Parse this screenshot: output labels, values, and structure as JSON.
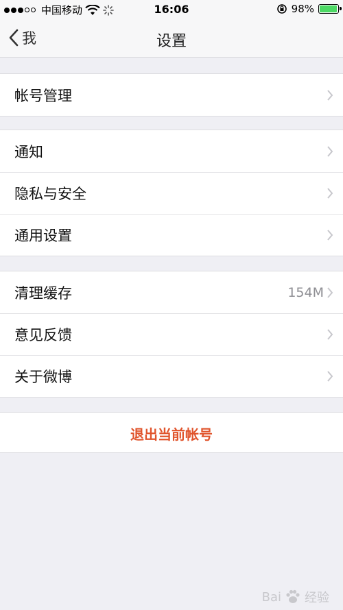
{
  "status_bar": {
    "carrier": "中国移动",
    "time": "16:06",
    "battery": "98%",
    "battery_level": 0.98
  },
  "nav": {
    "back_label": "我",
    "title": "设置"
  },
  "groups": [
    {
      "items": [
        {
          "label": "帐号管理",
          "value": ""
        }
      ]
    },
    {
      "items": [
        {
          "label": "通知",
          "value": ""
        },
        {
          "label": "隐私与安全",
          "value": ""
        },
        {
          "label": "通用设置",
          "value": ""
        }
      ]
    },
    {
      "items": [
        {
          "label": "清理缓存",
          "value": "154M"
        },
        {
          "label": "意见反馈",
          "value": ""
        },
        {
          "label": "关于微博",
          "value": ""
        }
      ]
    }
  ],
  "logout_label": "退出当前帐号",
  "watermark": {
    "brand": "Bai",
    "suffix": "经验"
  },
  "colors": {
    "accent": "#e0542c",
    "battery": "#4cd964",
    "background": "#efeff4"
  }
}
